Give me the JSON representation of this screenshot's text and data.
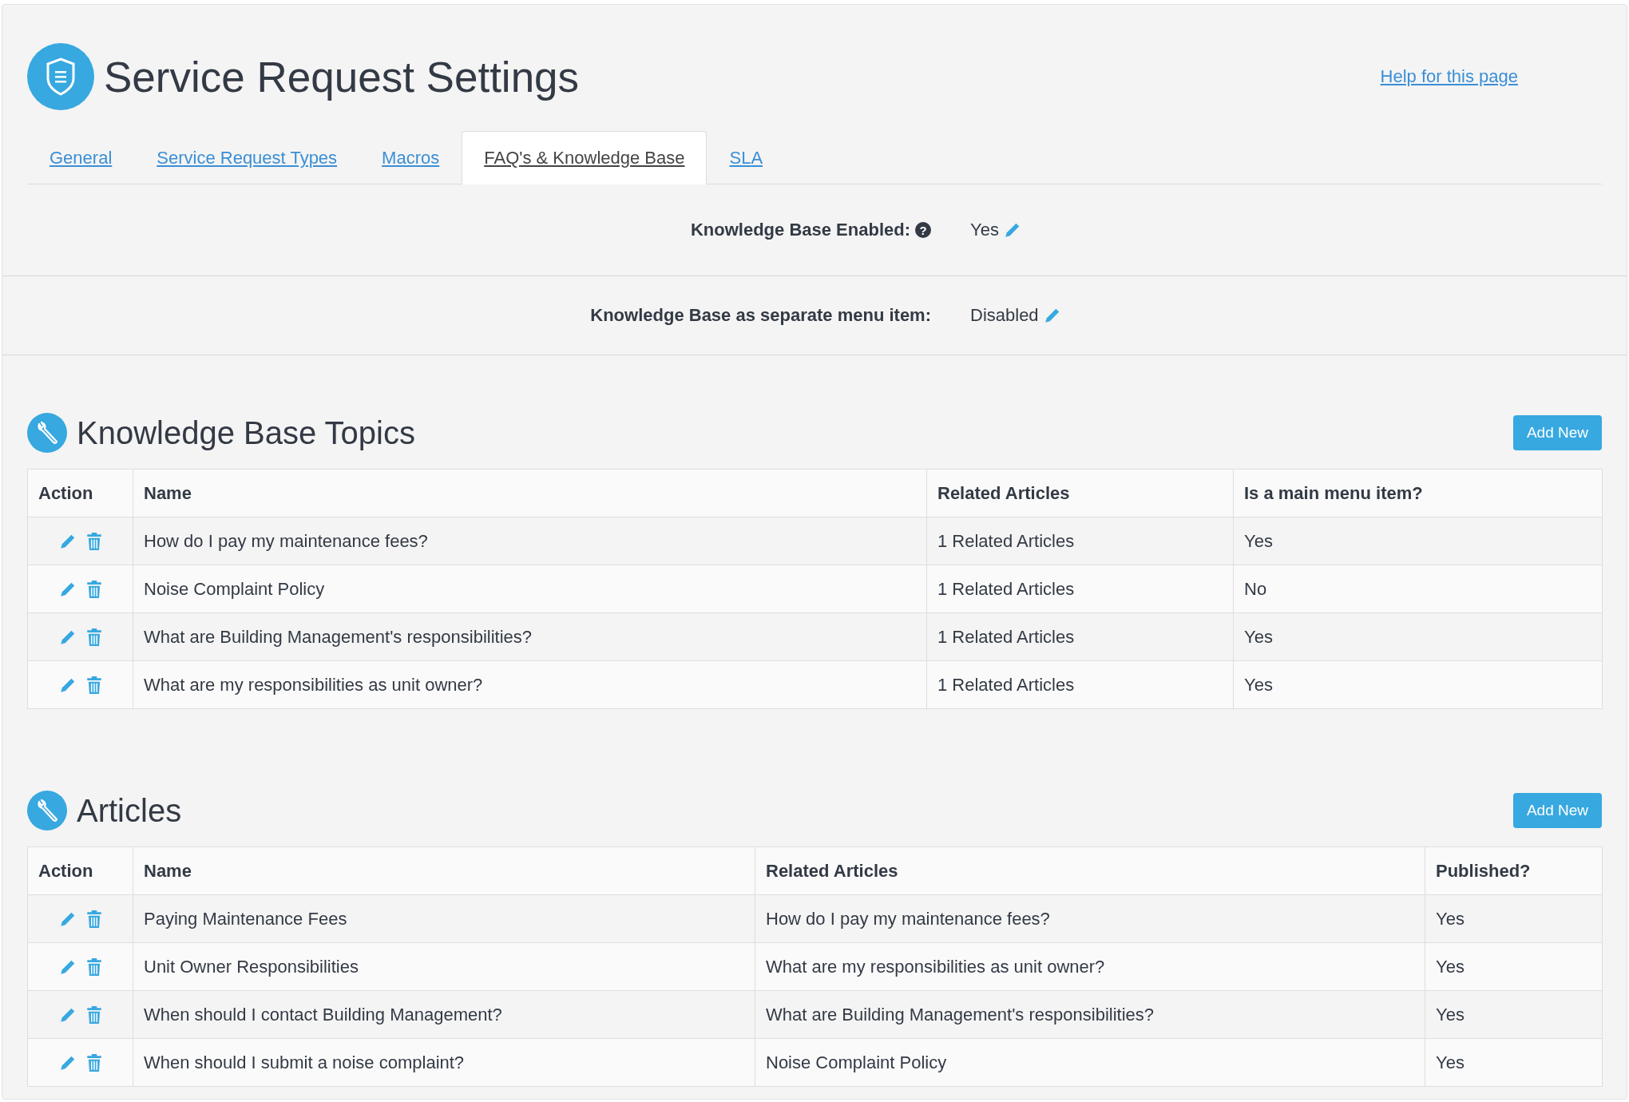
{
  "page": {
    "title": "Service Request Settings",
    "help_link": "Help for this page"
  },
  "tabs": [
    {
      "label": "General",
      "selected": false
    },
    {
      "label": "Service Request Types",
      "selected": false
    },
    {
      "label": "Macros",
      "selected": false
    },
    {
      "label": "FAQ's & Knowledge Base",
      "selected": true
    },
    {
      "label": "SLA",
      "selected": false
    }
  ],
  "settings": [
    {
      "label": "Knowledge Base Enabled:",
      "help": "?",
      "value": "Yes"
    },
    {
      "label": "Knowledge Base as separate menu item:",
      "value": "Disabled"
    }
  ],
  "sections": [
    {
      "title": "Knowledge Base Topics",
      "button": "Add New",
      "columns": [
        "Action",
        "Name",
        "Related Articles",
        "Is a main menu item?"
      ],
      "rows": [
        [
          "",
          "How do I pay my maintenance fees?",
          "1 Related Articles",
          "Yes"
        ],
        [
          "",
          "Noise Complaint Policy",
          "1 Related Articles",
          "No"
        ],
        [
          "",
          "What are Building Management's responsibilities?",
          "1 Related Articles",
          "Yes"
        ],
        [
          "",
          "What are my responsibilities as unit owner?",
          "1 Related Articles",
          "Yes"
        ]
      ]
    },
    {
      "title": "Articles",
      "button": "Add New",
      "columns": [
        "Action",
        "Name",
        "Related Articles",
        "Published?"
      ],
      "rows": [
        [
          "",
          "Paying Maintenance Fees",
          "How do I pay my maintenance fees?",
          "Yes"
        ],
        [
          "",
          "Unit Owner Responsibilities",
          "What are my responsibilities as unit owner?",
          "Yes"
        ],
        [
          "",
          "When should I contact Building Management?",
          "What are Building Management's responsibilities?",
          "Yes"
        ],
        [
          "",
          "When should I submit a noise complaint?",
          "Noise Complaint Policy",
          "Yes"
        ]
      ]
    }
  ]
}
